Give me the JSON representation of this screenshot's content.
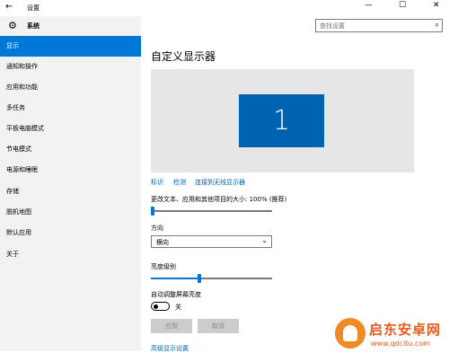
{
  "window": {
    "title": "设置",
    "back_icon": "←",
    "minimize_icon": "—",
    "maximize_icon": "☐",
    "close_icon": "✕"
  },
  "sidebar": {
    "header": "系统",
    "items": [
      {
        "label": "显示",
        "active": true
      },
      {
        "label": "通知和操作"
      },
      {
        "label": "应用和功能"
      },
      {
        "label": "多任务"
      },
      {
        "label": "平板电脑模式"
      },
      {
        "label": "节电模式"
      },
      {
        "label": "电源和睡眠"
      },
      {
        "label": "存储"
      },
      {
        "label": "脱机地图"
      },
      {
        "label": "默认应用"
      },
      {
        "label": "关于"
      }
    ]
  },
  "search": {
    "placeholder": "查找设置",
    "icon": "search-icon"
  },
  "main": {
    "title": "自定义显示器",
    "monitor_number": "1",
    "links": [
      "标识",
      "检测",
      "连接到无线显示器"
    ],
    "scale_label": "更改文本、应用和其他项目的大小: 100% (推荐)",
    "scale_value": 0,
    "orientation_label": "方向",
    "orientation_value": "横向",
    "brightness_label": "亮度级别",
    "brightness_value": 0.4,
    "auto_brightness_label": "自动调整屏幕亮度",
    "toggle_state": "关",
    "apply_button": "应用",
    "cancel_button": "取消",
    "advanced_link": "高级显示设置"
  },
  "watermark": {
    "title": "启东安卓网",
    "url": "www.qdcitu.com"
  },
  "colors": {
    "accent": "#0078d7",
    "monitor": "#0063b1",
    "sidebar_bg": "#f2f2f2",
    "preview_bg": "#e6e6e6"
  }
}
